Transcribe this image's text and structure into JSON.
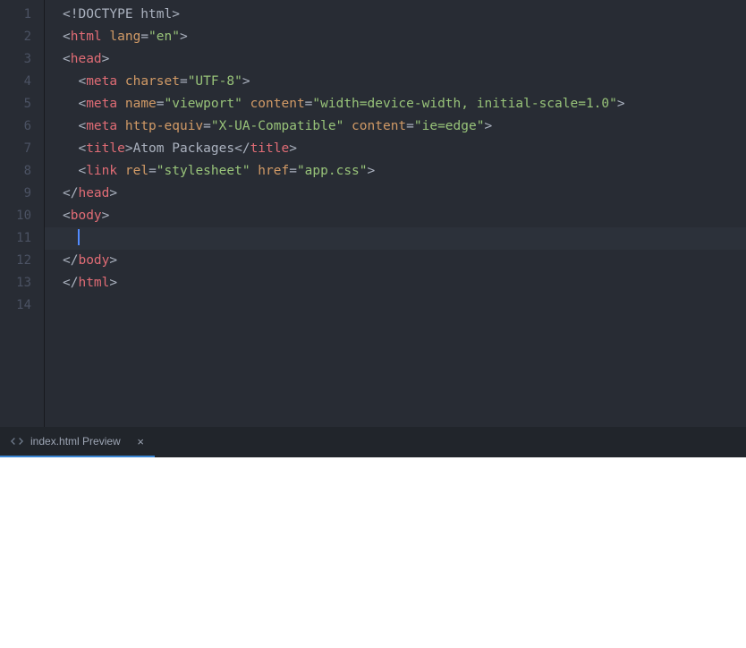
{
  "editor": {
    "lines": [
      {
        "num": "1",
        "indent": 0,
        "tokens": [
          {
            "t": "c-angle",
            "v": "<!"
          },
          {
            "t": "c-doctype",
            "v": "DOCTYPE html"
          },
          {
            "t": "c-angle",
            "v": ">"
          }
        ]
      },
      {
        "num": "2",
        "indent": 0,
        "tokens": [
          {
            "t": "c-angle",
            "v": "<"
          },
          {
            "t": "c-tag",
            "v": "html"
          },
          {
            "t": "c-text",
            "v": " "
          },
          {
            "t": "c-attr",
            "v": "lang"
          },
          {
            "t": "c-eq",
            "v": "="
          },
          {
            "t": "c-str",
            "v": "\"en\""
          },
          {
            "t": "c-angle",
            "v": ">"
          }
        ]
      },
      {
        "num": "3",
        "indent": 0,
        "tokens": [
          {
            "t": "c-angle",
            "v": "<"
          },
          {
            "t": "c-tag",
            "v": "head"
          },
          {
            "t": "c-angle",
            "v": ">"
          }
        ]
      },
      {
        "num": "4",
        "indent": 1,
        "tokens": [
          {
            "t": "c-angle",
            "v": "<"
          },
          {
            "t": "c-tag",
            "v": "meta"
          },
          {
            "t": "c-text",
            "v": " "
          },
          {
            "t": "c-attr",
            "v": "charset"
          },
          {
            "t": "c-eq",
            "v": "="
          },
          {
            "t": "c-str",
            "v": "\"UTF-8\""
          },
          {
            "t": "c-angle",
            "v": ">"
          }
        ]
      },
      {
        "num": "5",
        "indent": 1,
        "tokens": [
          {
            "t": "c-angle",
            "v": "<"
          },
          {
            "t": "c-tag",
            "v": "meta"
          },
          {
            "t": "c-text",
            "v": " "
          },
          {
            "t": "c-attr",
            "v": "name"
          },
          {
            "t": "c-eq",
            "v": "="
          },
          {
            "t": "c-str",
            "v": "\"viewport\""
          },
          {
            "t": "c-text",
            "v": " "
          },
          {
            "t": "c-attr",
            "v": "content"
          },
          {
            "t": "c-eq",
            "v": "="
          },
          {
            "t": "c-str",
            "v": "\"width=device-width, initial-scale=1.0\""
          },
          {
            "t": "c-angle",
            "v": ">"
          }
        ]
      },
      {
        "num": "6",
        "indent": 1,
        "tokens": [
          {
            "t": "c-angle",
            "v": "<"
          },
          {
            "t": "c-tag",
            "v": "meta"
          },
          {
            "t": "c-text",
            "v": " "
          },
          {
            "t": "c-attr",
            "v": "http-equiv"
          },
          {
            "t": "c-eq",
            "v": "="
          },
          {
            "t": "c-str",
            "v": "\"X-UA-Compatible\""
          },
          {
            "t": "c-text",
            "v": " "
          },
          {
            "t": "c-attr",
            "v": "content"
          },
          {
            "t": "c-eq",
            "v": "="
          },
          {
            "t": "c-str",
            "v": "\"ie=edge\""
          },
          {
            "t": "c-angle",
            "v": ">"
          }
        ]
      },
      {
        "num": "7",
        "indent": 1,
        "tokens": [
          {
            "t": "c-angle",
            "v": "<"
          },
          {
            "t": "c-tag",
            "v": "title"
          },
          {
            "t": "c-angle",
            "v": ">"
          },
          {
            "t": "c-text",
            "v": "Atom Packages"
          },
          {
            "t": "c-angle",
            "v": "</"
          },
          {
            "t": "c-tag",
            "v": "title"
          },
          {
            "t": "c-angle",
            "v": ">"
          }
        ]
      },
      {
        "num": "8",
        "indent": 1,
        "tokens": [
          {
            "t": "c-angle",
            "v": "<"
          },
          {
            "t": "c-tag",
            "v": "link"
          },
          {
            "t": "c-text",
            "v": " "
          },
          {
            "t": "c-attr",
            "v": "rel"
          },
          {
            "t": "c-eq",
            "v": "="
          },
          {
            "t": "c-str",
            "v": "\"stylesheet\""
          },
          {
            "t": "c-text",
            "v": " "
          },
          {
            "t": "c-attr",
            "v": "href"
          },
          {
            "t": "c-eq",
            "v": "="
          },
          {
            "t": "c-str",
            "v": "\"app.css\""
          },
          {
            "t": "c-angle",
            "v": ">"
          }
        ]
      },
      {
        "num": "9",
        "indent": 0,
        "tokens": [
          {
            "t": "c-angle",
            "v": "</"
          },
          {
            "t": "c-tag",
            "v": "head"
          },
          {
            "t": "c-angle",
            "v": ">"
          }
        ]
      },
      {
        "num": "10",
        "indent": 0,
        "tokens": [
          {
            "t": "c-angle",
            "v": "<"
          },
          {
            "t": "c-tag",
            "v": "body"
          },
          {
            "t": "c-angle",
            "v": ">"
          }
        ]
      },
      {
        "num": "11",
        "indent": 1,
        "active": true,
        "cursor": true,
        "tokens": []
      },
      {
        "num": "12",
        "indent": 0,
        "tokens": [
          {
            "t": "c-angle",
            "v": "</"
          },
          {
            "t": "c-tag",
            "v": "body"
          },
          {
            "t": "c-angle",
            "v": ">"
          }
        ]
      },
      {
        "num": "13",
        "indent": 0,
        "tokens": [
          {
            "t": "c-angle",
            "v": "</"
          },
          {
            "t": "c-tag",
            "v": "html"
          },
          {
            "t": "c-angle",
            "v": ">"
          }
        ]
      },
      {
        "num": "14",
        "indent": 0,
        "tokens": []
      }
    ]
  },
  "preview_tab": {
    "label": "index.html Preview",
    "close": "×"
  }
}
